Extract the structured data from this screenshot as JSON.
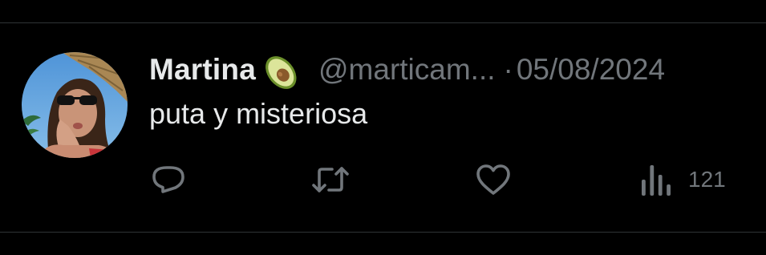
{
  "tweet": {
    "display_name": "Martina",
    "name_emoji": "avocado",
    "handle": "@marticam...",
    "separator": "·",
    "timestamp": "05/08/2024",
    "text": "puta y misteriosa",
    "views_count": "121"
  },
  "actions": [
    {
      "name": "reply",
      "icon": "speech-bubble-icon"
    },
    {
      "name": "retweet",
      "icon": "repost-arrows-icon"
    },
    {
      "name": "like",
      "icon": "heart-outline-icon"
    },
    {
      "name": "views",
      "icon": "bar-chart-icon"
    }
  ],
  "colors": {
    "background": "#000000",
    "primary_text": "#e7e9ea",
    "secondary_text": "#71767b",
    "divider": "#2f3336"
  }
}
